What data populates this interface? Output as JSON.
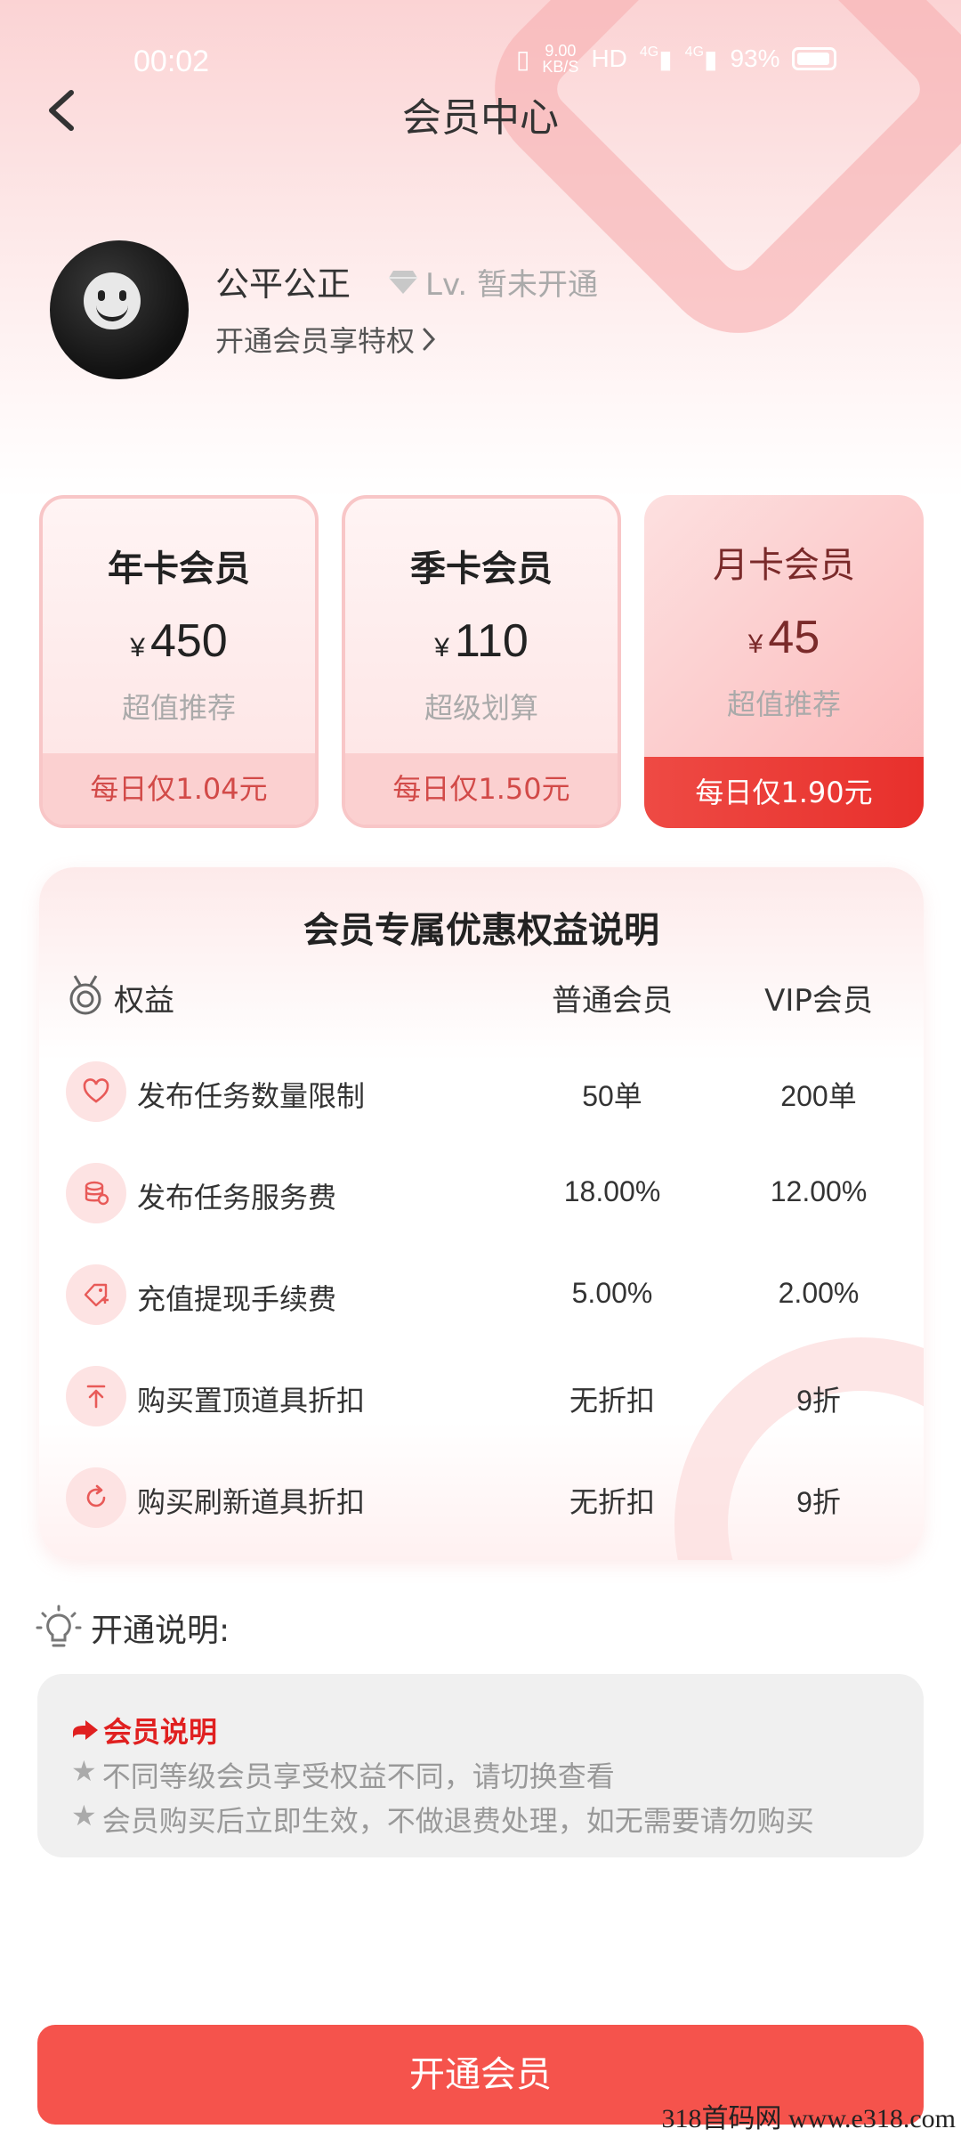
{
  "status_bar": {
    "time": "00:02",
    "speed_value": "9.00",
    "speed_unit": "KB/S",
    "hd": "HD",
    "net1": "4G",
    "net2": "4G",
    "battery": "93%"
  },
  "nav": {
    "title": "会员中心"
  },
  "profile": {
    "name": "公平公正",
    "level": "Lv. 暂未开通",
    "subtitle": "开通会员享特权"
  },
  "plans": [
    {
      "name": "年卡会员",
      "currency": "¥",
      "price": "450",
      "tag": "超值推荐",
      "daily": "每日仅1.04元",
      "selected": false
    },
    {
      "name": "季卡会员",
      "currency": "¥",
      "price": "110",
      "tag": "超级划算",
      "daily": "每日仅1.50元",
      "selected": false
    },
    {
      "name": "月卡会员",
      "currency": "¥",
      "price": "45",
      "tag": "超值推荐",
      "daily": "每日仅1.90元",
      "selected": true
    }
  ],
  "benefits": {
    "title": "会员专属优惠权益说明",
    "header": {
      "label": "权益",
      "col1": "普通会员",
      "col2": "VIP会员"
    },
    "rows": [
      {
        "icon": "heart-icon",
        "label": "发布任务数量限制",
        "normal": "50单",
        "vip": "200单"
      },
      {
        "icon": "coins-icon",
        "label": "发布任务服务费",
        "normal": "18.00%",
        "vip": "12.00%"
      },
      {
        "icon": "ticket-icon",
        "label": "充值提现手续费",
        "normal": "5.00%",
        "vip": "2.00%"
      },
      {
        "icon": "pin-top-icon",
        "label": "购买置顶道具折扣",
        "normal": "无折扣",
        "vip": "9折"
      },
      {
        "icon": "refresh-icon",
        "label": "购买刷新道具折扣",
        "normal": "无折扣",
        "vip": "9折"
      }
    ]
  },
  "notes": {
    "title": "开通说明:",
    "head": "会员说明",
    "lines": [
      "不同等级会员享受权益不同，请切换查看",
      "会员购买后立即生效，不做退费处理，如无需要请勿购买"
    ]
  },
  "cta": {
    "label": "开通会员"
  },
  "watermark": "318首码网 www.e318.com",
  "colors": {
    "accent": "#f5534c",
    "selected_daily": "#e8302c",
    "notes_head": "#e02020"
  }
}
